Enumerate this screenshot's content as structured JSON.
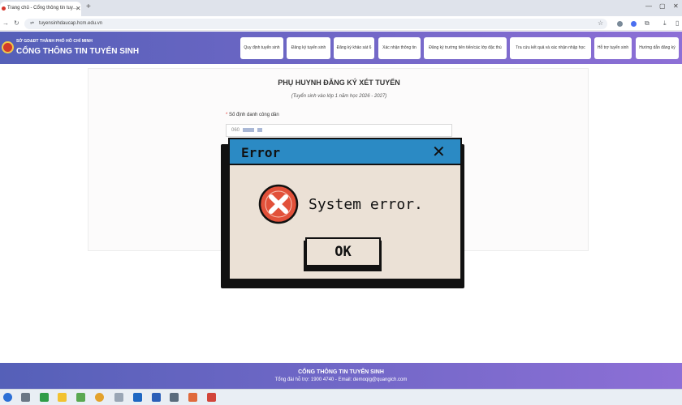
{
  "browser": {
    "tab_title": "Trang chủ - Cổng thông tin tuy…",
    "url": "tuyensinhdaucap.hcm.edu.vn",
    "icons": [
      "back-icon",
      "forward-icon",
      "reload-icon",
      "site-info-icon",
      "star-icon",
      "extension-icon",
      "download-icon",
      "sidebar-icon",
      "profile-icon",
      "more-icon"
    ]
  },
  "site": {
    "department": "SỞ GD&ĐT THÀNH PHỐ HỒ CHÍ MINH",
    "portal_name": "CỔNG THÔNG TIN TUYỂN SINH",
    "menu": [
      {
        "label": "Quy định tuyển sinh"
      },
      {
        "label": "Đăng ký tuyển sinh"
      },
      {
        "label": "Đăng ký khảo sát 6"
      },
      {
        "label": "Xác nhận thông tin"
      },
      {
        "label": "Đăng ký trường tiên tiến/các lớp đặc thù"
      },
      {
        "label": "Tra cứu kết quả và xác nhận nhập học"
      },
      {
        "label": "Hỗ trợ tuyển sinh"
      },
      {
        "label": "Hướng dẫn đăng ký"
      }
    ]
  },
  "form": {
    "title": "PHỤ HUYNH ĐĂNG KÝ XÉT TUYỂN",
    "subtitle": "(Tuyển sinh vào lớp 1 năm học 2026 - 2027)",
    "field_label": "Số định danh công dân",
    "required_mark": "*",
    "field_value": "060"
  },
  "dialog": {
    "title": "Error",
    "message": "System error.",
    "ok_label": "OK",
    "icon": "error-x-icon",
    "colors": {
      "titlebar": "#2b8ac4",
      "body": "#ebe1d6",
      "icon": "#e2513a"
    }
  },
  "footer": {
    "title": "CỔNG THÔNG TIN TUYỂN SINH",
    "contact": "Tổng đài hỗ trợ: 1900 4740 - Email: demoqig@quangich.com"
  },
  "colors": {
    "header_gradient_start": "#5560b8",
    "header_gradient_end": "#8d6fd6"
  }
}
